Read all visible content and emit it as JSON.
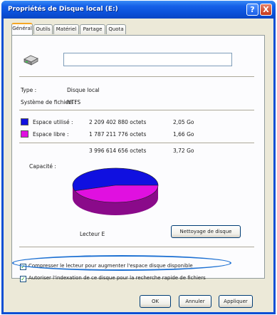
{
  "window": {
    "title": "Propriétés de Disque local (E:)",
    "help_label": "?",
    "close_label": "X"
  },
  "tabs": [
    {
      "label": "Général",
      "active": true
    },
    {
      "label": "Outils",
      "active": false
    },
    {
      "label": "Matériel",
      "active": false
    },
    {
      "label": "Partage",
      "active": false
    },
    {
      "label": "Quota",
      "active": false
    }
  ],
  "general": {
    "drive_icon": "hard-drive-icon",
    "name_value": "",
    "type_label": "Type :",
    "type_value": "Disque local",
    "fs_label": "Système de fichiers :",
    "fs_value": "NTFS",
    "used": {
      "label": "Espace utilisé :",
      "bytes": "2 209 402 880 octets",
      "size": "2,05 Go",
      "color": "#1010e0"
    },
    "free": {
      "label": "Espace libre :",
      "bytes": "1 787 211 776 octets",
      "size": "1,66 Go",
      "color": "#e010e0"
    },
    "capacity": {
      "label": "Capacité :",
      "bytes": "3 996 614 656 octets",
      "size": "3,72 Go"
    },
    "drive_label": "Lecteur E",
    "cleanup_button": "Nettoyage de disque",
    "compress_label": "Compresser le lecteur pour augmenter l'espace disque disponible",
    "compress_checked": true,
    "index_label": "Autoriser l'indexation de ce disque pour la recherche rapide de fichiers",
    "index_checked": true
  },
  "chart_data": {
    "type": "pie",
    "categories": [
      "Espace utilisé",
      "Espace libre"
    ],
    "values": [
      2209402880,
      1787211776
    ],
    "colors": [
      "#1010e0",
      "#e010e0"
    ]
  },
  "footer": {
    "ok": "OK",
    "cancel": "Annuler",
    "apply": "Appliquer"
  }
}
